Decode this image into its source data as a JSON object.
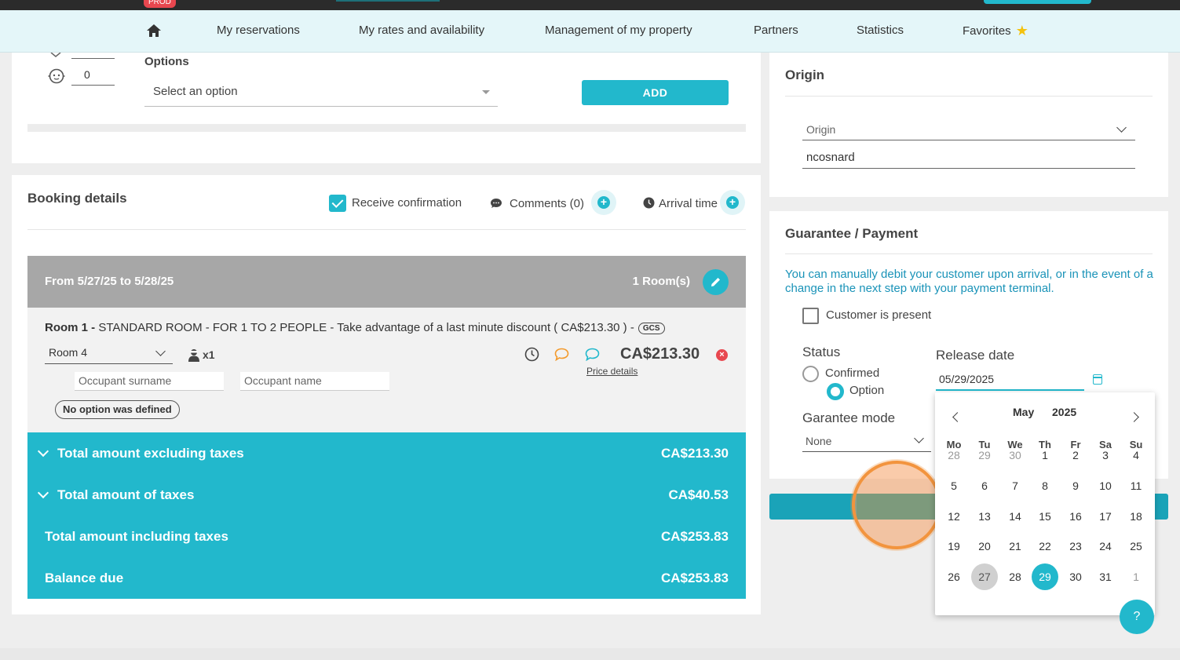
{
  "env": {
    "badge": "PROD"
  },
  "nav": {
    "items": [
      "My reservations",
      "My rates and availability",
      "Management of my property",
      "Partners",
      "Statistics",
      "Favorites"
    ]
  },
  "guests": {
    "count": "0"
  },
  "options": {
    "label": "Options",
    "placeholder": "Select an option",
    "add_label": "ADD"
  },
  "booking": {
    "title": "Booking details",
    "receive_confirmation": "Receive confirmation",
    "comments": "Comments (0)",
    "arrival_time": "Arrival time",
    "range": "From 5/27/25 to 5/28/25",
    "rooms_count": "1 Room(s)",
    "room": {
      "prefix": "Room 1 -",
      "description": "STANDARD ROOM - FOR 1 TO 2 PEOPLE - Take advantage of a last minute discount ( CA$213.30 ) -",
      "badge": "GCS",
      "room_select": "Room 4",
      "occupants": "x1",
      "surname_placeholder": "Occupant surname",
      "name_placeholder": "Occupant name",
      "no_option": "No option was defined",
      "price": "CA$213.30",
      "price_details": "Price details"
    }
  },
  "totals": [
    {
      "label": "Total amount excluding taxes",
      "value": "CA$213.30"
    },
    {
      "label": "Total amount of taxes",
      "value": "CA$40.53"
    },
    {
      "label": "Total amount including taxes",
      "value": "CA$253.83"
    },
    {
      "label": "Balance due",
      "value": "CA$253.83"
    }
  ],
  "origin": {
    "title": "Origin",
    "field_label": "Origin",
    "value": "ncosnard"
  },
  "guarantee": {
    "title": "Guarantee / Payment",
    "info": "You can manually debit your customer upon arrival, or in the event of a change in the next step with your payment terminal.",
    "customer_present": "Customer is present",
    "status_label": "Status",
    "status_confirmed": "Confirmed",
    "status_option": "Option",
    "release_label": "Release date",
    "release_value": "05/29/2025",
    "mode_label": "Garantee mode",
    "mode_value": "None"
  },
  "datepicker": {
    "month": "May",
    "year": "2025",
    "weekdays": [
      "Mo",
      "Tu",
      "We",
      "Th",
      "Fr",
      "Sa",
      "Su"
    ],
    "weeks": [
      [
        "28",
        "29",
        "30",
        "1",
        "2",
        "3",
        "4"
      ],
      [
        "5",
        "6",
        "7",
        "8",
        "9",
        "10",
        "11"
      ],
      [
        "12",
        "13",
        "14",
        "15",
        "16",
        "17",
        "18"
      ],
      [
        "19",
        "20",
        "21",
        "22",
        "23",
        "24",
        "25"
      ],
      [
        "26",
        "27",
        "28",
        "29",
        "30",
        "31",
        "1"
      ]
    ],
    "today": "27",
    "selected": "29"
  },
  "help": {
    "label": "?"
  },
  "colors": {
    "accent": "#22b8cc",
    "danger": "#e8474f",
    "star": "#f4c20d",
    "info": "#1a93b8"
  }
}
